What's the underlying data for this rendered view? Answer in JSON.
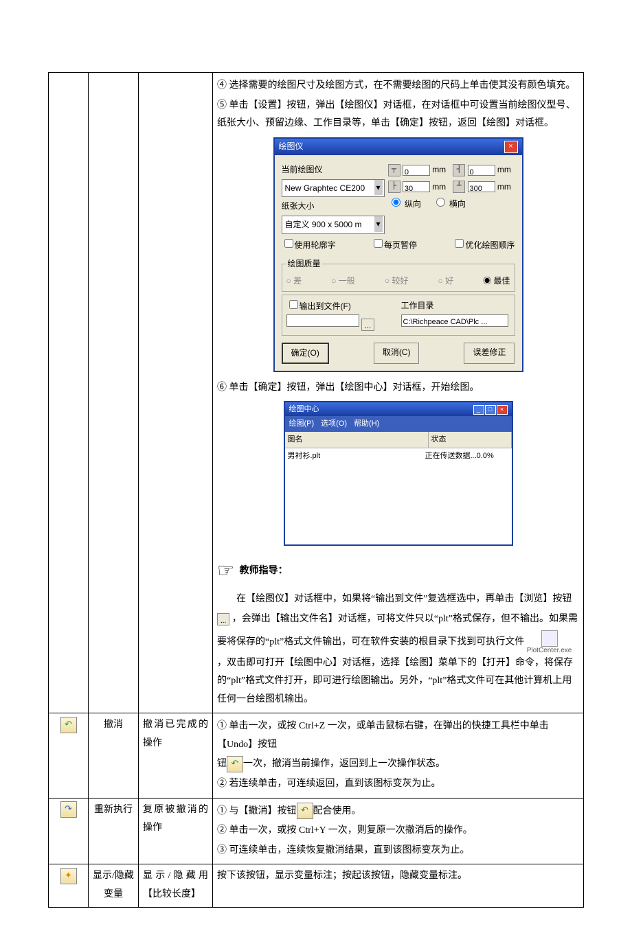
{
  "steps": {
    "s4": "④ 选择需要的绘图尺寸及绘图方式，在不需要绘图的尺码上单击使其没有颜色填充。",
    "s5": "⑤ 单击【设置】按钮，弹出【绘图仪】对话框，在对话框中可设置当前绘图仪型号、纸张大小、预留边缘、工作目录等，单击【确定】按钮，返回【绘图】对话框。",
    "s6": "⑥ 单击【确定】按钮，弹出【绘图中心】对话框，开始绘图。"
  },
  "plotter": {
    "title": "绘图仪",
    "current_label": "当前绘图仪",
    "current_value": "New Graphtec CE200",
    "paper_label": "纸张大小",
    "paper_value": "自定义 900 x 5000 m",
    "margins": {
      "top_val": "0",
      "top_unit": "mm",
      "right_val": "0",
      "right_unit": "mm",
      "left_val": "30",
      "left_unit": "mm",
      "bottom_val": "300",
      "bottom_unit": "mm"
    },
    "orient": {
      "portrait": "纵向",
      "landscape": "横向"
    },
    "opts": {
      "outline": "使用轮廓字",
      "pageStop": "每页暂停",
      "optimize": "优化绘图顺序"
    },
    "quality": {
      "legend": "绘图质量",
      "q1": "差",
      "q2": "一般",
      "q3": "较好",
      "q4": "好",
      "q5": "最佳"
    },
    "outfile": {
      "chk": "输出到文件(F)",
      "browse": "..."
    },
    "workdir": {
      "label": "工作目录",
      "value": "C:\\Richpeace CAD\\Plc ..."
    },
    "buttons": {
      "ok": "确定(O)",
      "cancel": "取消(C)",
      "fix": "误差修正"
    }
  },
  "center": {
    "title": "绘图中心",
    "menus": [
      "绘图(P)",
      "选项(O)",
      "帮助(H)"
    ],
    "cols": {
      "name": "图名",
      "status": "状态"
    },
    "row": {
      "name": "男衬衫.plt",
      "status": "正在传送数据...0.0%"
    }
  },
  "teacher": {
    "heading": "教师指导：",
    "p1_a": "在【绘图仪】对话框中，如果将“输出到文件”复选框选中，再单击【浏览】按钮",
    "p1_b": "，会弹出【输出文件名】对话框，可将文件只以“plt”格式保存，但不输出。如果需",
    "p2_a": "要将保存的“plt”格式文件输出，可在软件安装的根目录下找到可执行文件 ",
    "app_label": "PlotCenter.exe",
    "p2_b": "，双击即可打开【绘图中心】对话框，选择【绘图】菜单下的【打开】命令，将保存的“plt”格式文件打开，即可进行绘图输出。另外，“plt”格式文件可在其他计算机上用任何一台绘图机输出。"
  },
  "rows": {
    "undo": {
      "name": "撤消",
      "desc": "撤消已完成的操作",
      "line1a": "① 单击一次，或按 Ctrl+Z 一次，或单击鼠标右键，在弹出的快捷工具栏中单击【Undo】按钮",
      "line1b": "一次，撤消当前操作，返回到上一次操作状态。",
      "line2": "② 若连续单击，可连续返回，直到该图标变灰为止。"
    },
    "redo": {
      "name": "重新执行",
      "desc": "复原被撤消的操作",
      "line1": "① 与【撤消】按钮",
      "line1b": "配合使用。",
      "line2": "② 单击一次，或按 Ctrl+Y 一次，则复原一次撤消后的操作。",
      "line3": "③ 可连续单击，连续恢复撤消结果，直到该图标变灰为止。"
    },
    "toggle": {
      "name": "显示/隐藏变量",
      "desc": "显示/隐藏用【比较长度】",
      "text": "按下该按钮，显示变量标注；按起该按钮，隐藏变量标注。"
    }
  }
}
